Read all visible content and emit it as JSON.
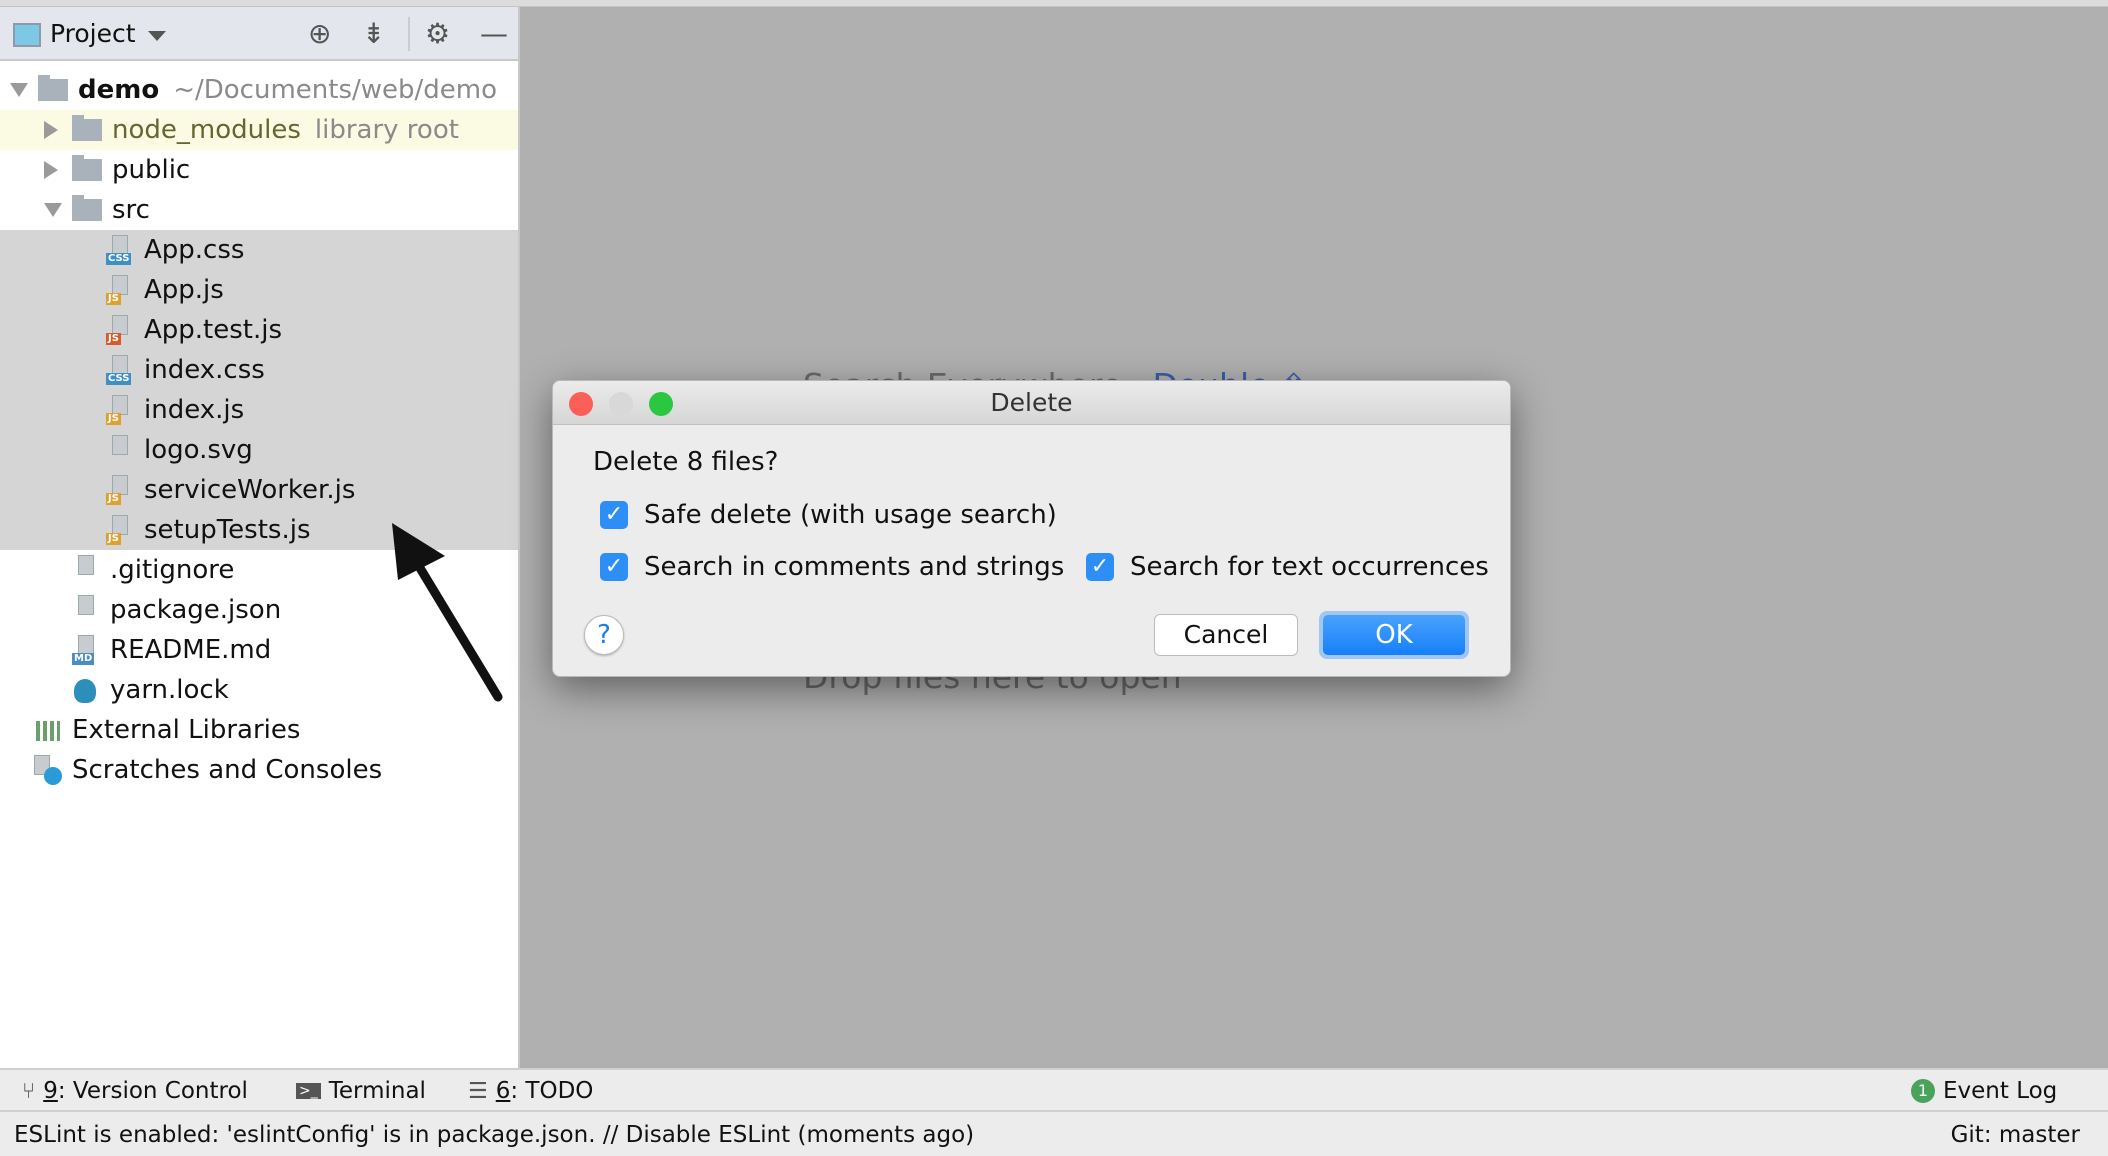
{
  "project_panel": {
    "title": "Project",
    "icons": [
      "locate-icon",
      "collapse-all-icon",
      "gear-icon",
      "minimize-icon"
    ],
    "tree": [
      {
        "label": "demo",
        "extra": "~/Documents/web/demo",
        "bold": true,
        "level": 0,
        "type": "folder",
        "expander": "open"
      },
      {
        "label": "node_modules",
        "extra": "library root",
        "level": 1,
        "type": "folder",
        "expander": "closed",
        "library": true
      },
      {
        "label": "public",
        "level": 1,
        "type": "folder",
        "expander": "closed"
      },
      {
        "label": "src",
        "level": 1,
        "type": "folder",
        "expander": "open"
      },
      {
        "label": "App.css",
        "level": 2,
        "type": "file",
        "tag": "CSS",
        "selected": true
      },
      {
        "label": "App.js",
        "level": 2,
        "type": "file",
        "tag": "JS",
        "selected": true
      },
      {
        "label": "App.test.js",
        "level": 2,
        "type": "file",
        "tag": "JS",
        "selected": true,
        "test": true
      },
      {
        "label": "index.css",
        "level": 2,
        "type": "file",
        "tag": "CSS",
        "selected": true
      },
      {
        "label": "index.js",
        "level": 2,
        "type": "file",
        "tag": "JS",
        "selected": true
      },
      {
        "label": "logo.svg",
        "level": 2,
        "type": "file",
        "tag": "",
        "selected": true
      },
      {
        "label": "serviceWorker.js",
        "level": 2,
        "type": "file",
        "tag": "JS",
        "selected": true
      },
      {
        "label": "setupTests.js",
        "level": 2,
        "type": "file",
        "tag": "JS",
        "selected": true
      },
      {
        "label": ".gitignore",
        "level": 1,
        "type": "file",
        "tag": ""
      },
      {
        "label": "package.json",
        "level": 1,
        "type": "file",
        "tag": "{}"
      },
      {
        "label": "README.md",
        "level": 1,
        "type": "file",
        "tag": "MD"
      },
      {
        "label": "yarn.lock",
        "level": 1,
        "type": "file",
        "tag": "yarn"
      },
      {
        "label": "External Libraries",
        "level": 0,
        "type": "libraries"
      },
      {
        "label": "Scratches and Consoles",
        "level": 0,
        "type": "scratches"
      }
    ]
  },
  "editor_empty": {
    "search_hint": "Search Everywhere",
    "search_shortcut": "Double ⇧",
    "drop_hint": "Drop files here to open"
  },
  "dialog": {
    "title": "Delete",
    "message": "Delete 8 files?",
    "options": [
      {
        "label": "Safe delete (with usage search)",
        "checked": true
      },
      {
        "label": "Search in comments and strings",
        "checked": true
      },
      {
        "label": "Search for text occurrences",
        "checked": true
      }
    ],
    "help": "?",
    "cancel": "Cancel",
    "ok": "OK",
    "colors": {
      "close": "#fc5f57",
      "minimize": "#d8d8d8",
      "maximize": "#2ac840",
      "accent": "#1a84fb"
    }
  },
  "tool_windows": {
    "version_control": {
      "num": "9",
      "label": ": Version Control"
    },
    "terminal": "Terminal",
    "todo": {
      "num": "6",
      "label": ": TODO"
    },
    "event_log": "Event Log",
    "event_count": "1"
  },
  "status_bar": {
    "message": "ESLint is enabled: 'eslintConfig' is in package.json. // Disable ESLint (moments ago)",
    "git": "Git: master"
  }
}
